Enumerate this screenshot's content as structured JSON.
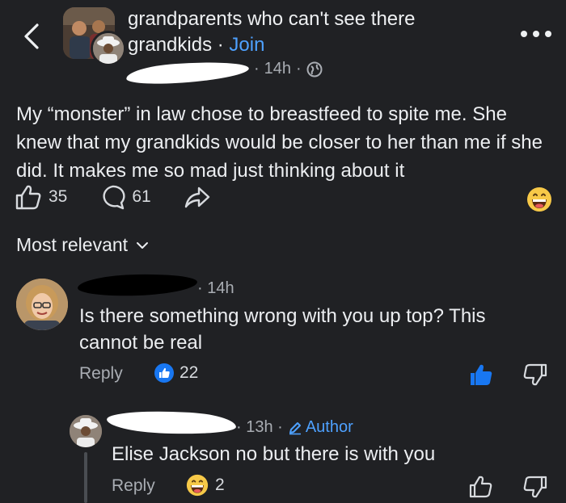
{
  "header": {
    "group_title": "grandparents who can't see there grandkids",
    "separator": "·",
    "join_label": "Join",
    "time": "14h",
    "globe_icon": "globe-icon"
  },
  "post": {
    "text": "My “monster” in law chose to breastfeed to spite me. She knew that my grandkids would be closer to her than me if she did. It makes me so mad just thinking about it",
    "like_count": "35",
    "comment_count": "61"
  },
  "sort_label": "Most relevant",
  "comments": [
    {
      "time": "· 14h",
      "text": "Is there something wrong with you up top? This cannot be real",
      "reply_label": "Reply",
      "like_count": "22"
    },
    {
      "time": "· 13h ·",
      "author_label": "Author",
      "text": "Elise Jackson no but there is with you",
      "reply_label": "Reply",
      "react_count": "2"
    }
  ],
  "colors": {
    "background": "#202124",
    "accent": "#4ea1ff",
    "like_blue": "#1877f2",
    "emoji_yellow": "#f7c948"
  }
}
